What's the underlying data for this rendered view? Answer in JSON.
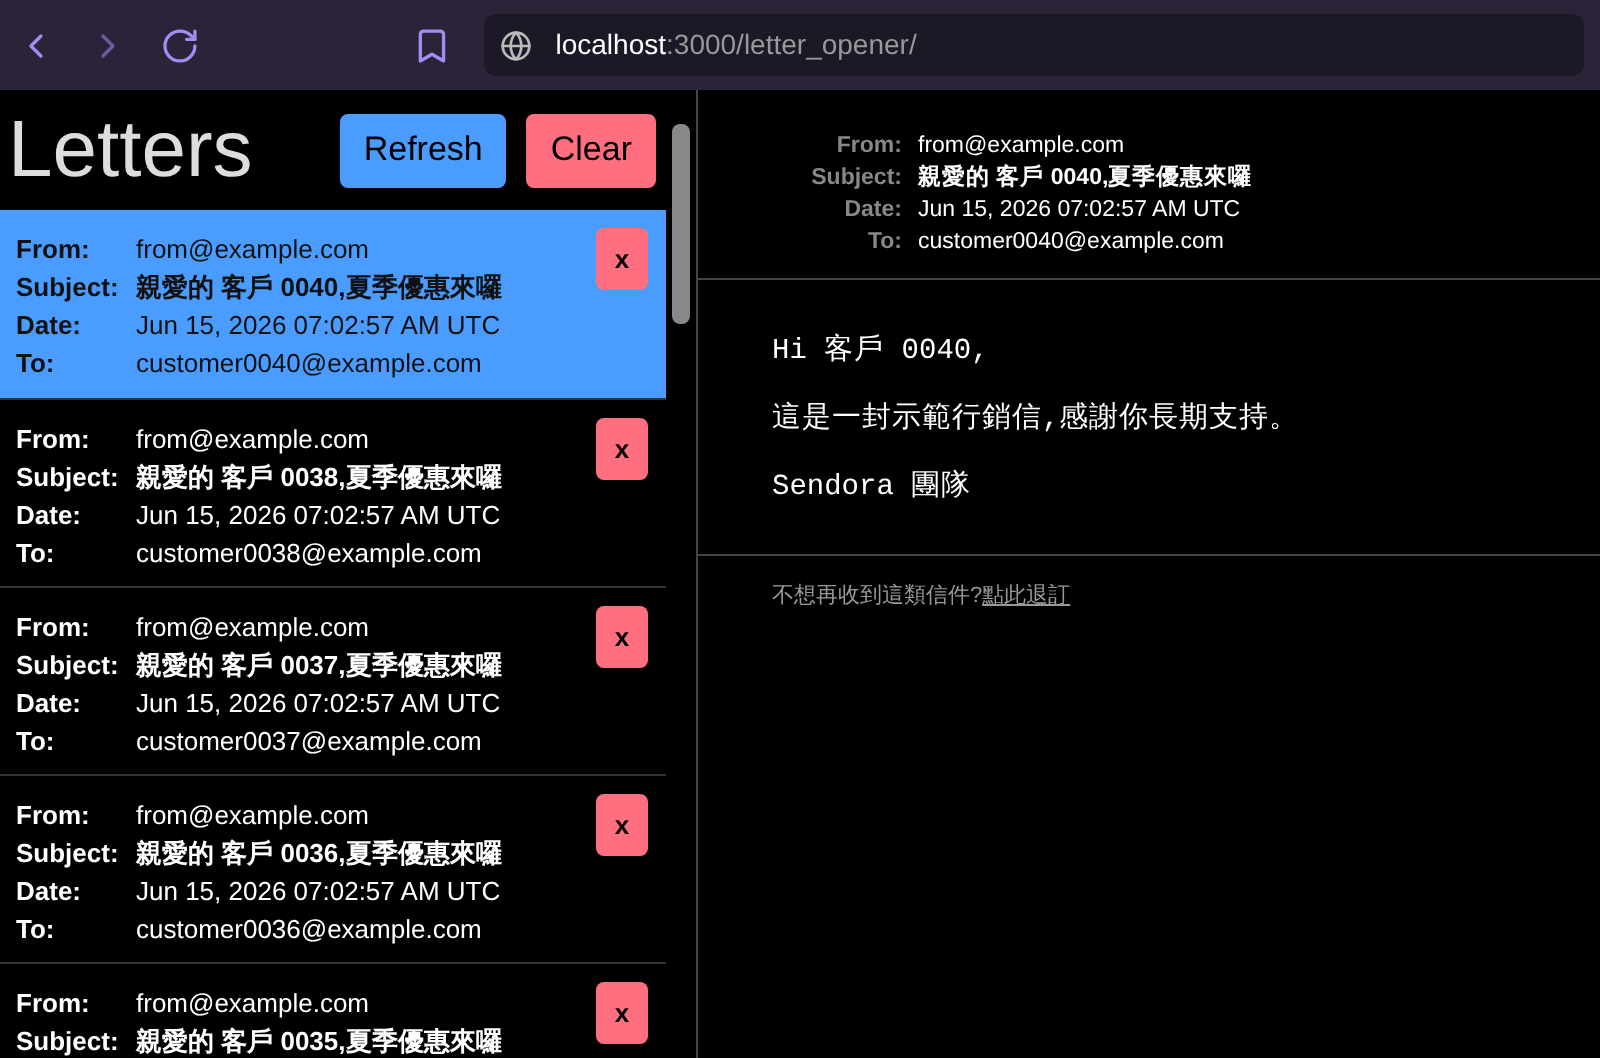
{
  "browser": {
    "url_host": "localhost",
    "url_path": ":3000/letter_opener/"
  },
  "sidebar": {
    "title": "Letters",
    "buttons": [
      {
        "label": "Refresh",
        "kind": "refresh"
      },
      {
        "label": "Clear",
        "kind": "clear"
      }
    ]
  },
  "letters": [
    {
      "selected": true,
      "delete_label": "x",
      "fields": [
        {
          "label": "From:",
          "value": "from@example.com"
        },
        {
          "label": "Subject:",
          "value": "親愛的 客戶 0040,夏季優惠來囉",
          "kind": "subject"
        },
        {
          "label": "Date:",
          "value": "Jun 15, 2026 07:02:57 AM UTC"
        },
        {
          "label": "To:",
          "value": "customer0040@example.com"
        }
      ]
    },
    {
      "selected": false,
      "delete_label": "x",
      "fields": [
        {
          "label": "From:",
          "value": "from@example.com"
        },
        {
          "label": "Subject:",
          "value": "親愛的 客戶 0038,夏季優惠來囉",
          "kind": "subject"
        },
        {
          "label": "Date:",
          "value": "Jun 15, 2026 07:02:57 AM UTC"
        },
        {
          "label": "To:",
          "value": "customer0038@example.com"
        }
      ]
    },
    {
      "selected": false,
      "delete_label": "x",
      "fields": [
        {
          "label": "From:",
          "value": "from@example.com"
        },
        {
          "label": "Subject:",
          "value": "親愛的 客戶 0037,夏季優惠來囉",
          "kind": "subject"
        },
        {
          "label": "Date:",
          "value": "Jun 15, 2026 07:02:57 AM UTC"
        },
        {
          "label": "To:",
          "value": "customer0037@example.com"
        }
      ]
    },
    {
      "selected": false,
      "delete_label": "x",
      "fields": [
        {
          "label": "From:",
          "value": "from@example.com"
        },
        {
          "label": "Subject:",
          "value": "親愛的 客戶 0036,夏季優惠來囉",
          "kind": "subject"
        },
        {
          "label": "Date:",
          "value": "Jun 15, 2026 07:02:57 AM UTC"
        },
        {
          "label": "To:",
          "value": "customer0036@example.com"
        }
      ]
    },
    {
      "selected": false,
      "delete_label": "x",
      "fields": [
        {
          "label": "From:",
          "value": "from@example.com"
        },
        {
          "label": "Subject:",
          "value": "親愛的 客戶 0035,夏季優惠來囉",
          "kind": "subject"
        }
      ]
    }
  ],
  "message": {
    "headers": [
      {
        "label": "From:",
        "value": "from@example.com"
      },
      {
        "label": "Subject:",
        "value": "親愛的 客戶 0040,夏季優惠來囉",
        "kind": "subject"
      },
      {
        "label": "Date:",
        "value": "Jun 15, 2026 07:02:57 AM UTC"
      },
      {
        "label": "To:",
        "value": "customer0040@example.com"
      }
    ],
    "body": [
      "Hi 客戶 0040,",
      "這是一封示範行銷信,感謝你長期支持。",
      "Sendora 團隊"
    ],
    "footer": {
      "text": "不想再收到這類信件?",
      "link": "點此退訂"
    }
  }
}
